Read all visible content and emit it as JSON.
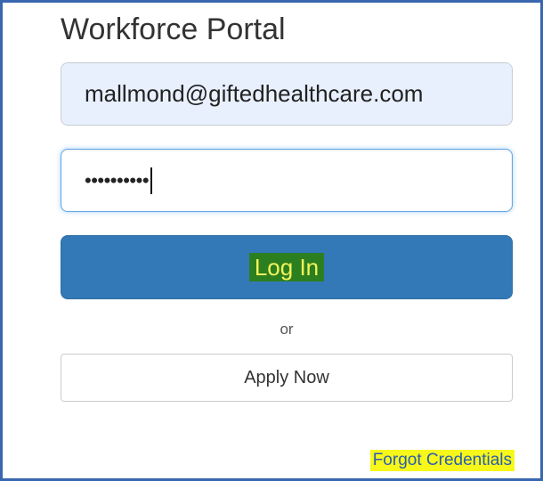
{
  "header": {
    "title": "Workforce Portal"
  },
  "login_form": {
    "email_value": "mallmond@giftedhealthcare.com",
    "password_masked": "••••••••••",
    "login_label": "Log In",
    "or_text": "or",
    "apply_label": "Apply Now",
    "forgot_label": "Forgot Credentials"
  },
  "colors": {
    "primary_button": "#3379b7",
    "highlight_green": "#2c7f1e",
    "highlight_yellow": "#f7f719",
    "link": "#2a5db0",
    "frame_border": "#3a66b0"
  }
}
